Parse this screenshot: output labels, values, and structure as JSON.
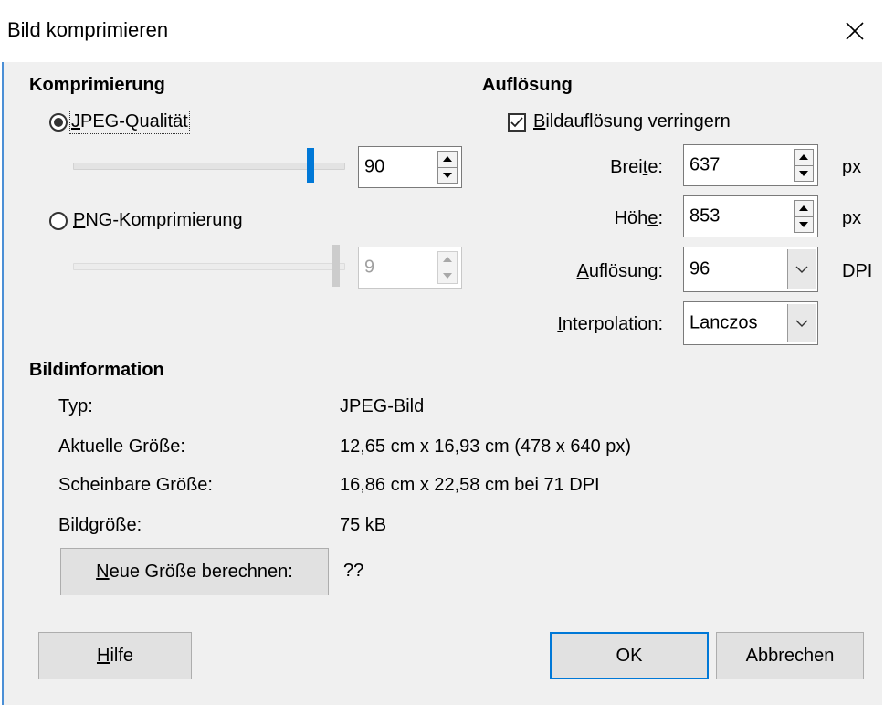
{
  "window": {
    "title": "Bild komprimieren",
    "close_icon": "close-icon"
  },
  "compression": {
    "title": "Komprimierung",
    "jpeg": {
      "label_mnemonic": "J",
      "label_rest": "PEG-Qualität",
      "selected": true,
      "value": "90",
      "slider_level_percent": 90
    },
    "png": {
      "label_mnemonic": "P",
      "label_rest": "NG-Komprimierung",
      "selected": false,
      "value": "9",
      "slider_level_percent": 100
    }
  },
  "resolution": {
    "title": "Auflösung",
    "reduce": {
      "label_mnemonic": "B",
      "label_rest": "ildauflösung verringern",
      "checked": true
    },
    "width": {
      "label_pre": "Brei",
      "label_mnemonic": "t",
      "label_post": "e:",
      "value": "637",
      "unit": "px"
    },
    "height": {
      "label_pre": "Höh",
      "label_mnemonic": "e",
      "label_post": ":",
      "value": "853",
      "unit": "px"
    },
    "dpi": {
      "label_mnemonic": "A",
      "label_post": "uflösung:",
      "value": "96",
      "unit": "DPI"
    },
    "interpolation": {
      "label_mnemonic": "I",
      "label_post": "nterpolation:",
      "value": "Lanczos"
    }
  },
  "info": {
    "title": "Bildinformation",
    "rows": [
      {
        "label": "Typ:",
        "value": "JPEG-Bild"
      },
      {
        "label": "Aktuelle Größe:",
        "value": "12,65 cm x 16,93 cm (478 x 640 px)"
      },
      {
        "label": "Scheinbare Größe:",
        "value": "16,86 cm x 22,58 cm bei 71 DPI"
      },
      {
        "label": "Bildgröße:",
        "value": "75 kB"
      }
    ],
    "calc_button": {
      "label_mnemonic": "N",
      "label_rest": "eue Größe berechnen:"
    },
    "calc_result": "??"
  },
  "buttons": {
    "help": {
      "label_mnemonic": "H",
      "label_rest": "ilfe"
    },
    "ok": "OK",
    "cancel": "Abbrechen"
  }
}
